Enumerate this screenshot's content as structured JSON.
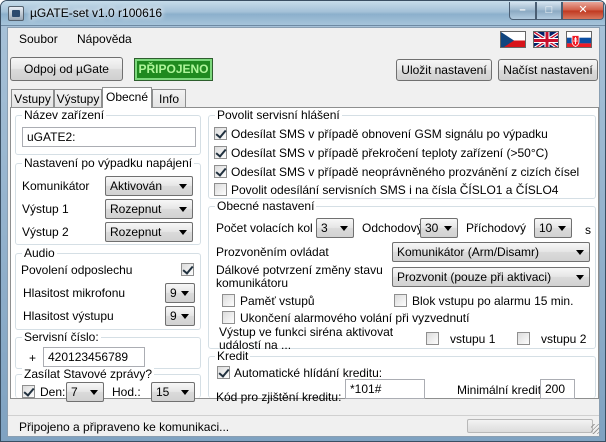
{
  "window": {
    "title": "µGATE-set v1.0 r100616",
    "min_label": "–",
    "max_label": "□",
    "close_label": "✕"
  },
  "menu": {
    "items": [
      "Soubor",
      "Nápověda"
    ]
  },
  "flags": [
    "czech-flag-icon",
    "uk-flag-icon",
    "slovak-flag-icon"
  ],
  "toolbar": {
    "disconnect_label": "Odpoj od µGate",
    "status_label": "PŘIPOJENO",
    "save_label": "Uložit nastavení",
    "load_label": "Načíst nastavení"
  },
  "tabs": [
    {
      "label": "Vstupy",
      "active": false
    },
    {
      "label": "Výstupy",
      "active": false
    },
    {
      "label": "Obecné",
      "active": true
    },
    {
      "label": "Info",
      "active": false
    }
  ],
  "device_name": {
    "group_label": "Název zařízení",
    "value": "uGATE2:"
  },
  "power_loss": {
    "group_label": "Nastavení po výpadku napájení",
    "rows": [
      {
        "label": "Komunikátor",
        "value": "Aktivován"
      },
      {
        "label": "Výstup 1",
        "value": "Rozepnut"
      },
      {
        "label": "Výstup 2",
        "value": "Rozepnut"
      }
    ]
  },
  "audio": {
    "group_label": "Audio",
    "listen_label": "Povolení odposlechu",
    "listen_checked": true,
    "mic_label": "Hlasitost mikrofonu",
    "mic_value": "9",
    "out_label": "Hlasitost výstupu",
    "out_value": "9"
  },
  "service_number": {
    "group_label": "Servisní číslo:",
    "prefix": "+",
    "value": "420123456789"
  },
  "status_sms": {
    "group_label": "Zasílat Stavové zprávy?",
    "checked": true,
    "day_label": "Den:",
    "day_value": "7",
    "hour_label": "Hod.:",
    "hour_value": "15"
  },
  "service_reports": {
    "group_label": "Povolit servisní hlášení",
    "items": [
      {
        "label": "Odesílat SMS v případě obnovení GSM signálu po výpadku",
        "checked": true
      },
      {
        "label": "Odesílat SMS v případě překročení teploty zařízení (>50°C)",
        "checked": true
      },
      {
        "label": "Odesílat SMS v případě neoprávněného prozvánění z cizích čísel",
        "checked": true
      },
      {
        "label": "Povolit odesílání servisních SMS i na čísla ČÍSLO1 a ČÍSLO4",
        "checked": false
      }
    ]
  },
  "general": {
    "group_label": "Obecné nastavení",
    "rings_label": "Počet volacích kol",
    "rings_value": "3",
    "outgoing_label": "Odchodový",
    "outgoing_value": "30",
    "incoming_label": "Příchodový",
    "incoming_value": "10",
    "unit_label": "s",
    "ring_control_label": "Prozvoněním ovládat",
    "ring_control_value": "Komunikátor (Arm/Disamr)",
    "remote_confirm_label": "Dálkové potvrzení změny stavu komunikátoru",
    "remote_confirm_value": "Prozvonit (pouze při aktivaci)",
    "memory_label": "Paměť vstupů",
    "memory_checked": false,
    "block_label": "Blok vstupu po alarmu 15 min.",
    "block_checked": false,
    "end_call_label": "Ukončení alarmového volání při vyzvednutí",
    "end_call_checked": false,
    "siren_label": "Výstup ve funkci siréna aktivovat událostí na ...",
    "input1_label": "vstupu 1",
    "input1_checked": false,
    "input2_label": "vstupu 2",
    "input2_checked": false
  },
  "credit": {
    "group_label": "Kredit",
    "auto_label": "Automatické hlídání kreditu:",
    "auto_checked": true,
    "code_label": "Kód pro zjištění kreditu:",
    "code_value": "*101#",
    "min_label": "Minimální kredit:",
    "min_value": "200"
  },
  "statusbar": {
    "text": "Připojeno a připraveno ke komunikaci..."
  }
}
